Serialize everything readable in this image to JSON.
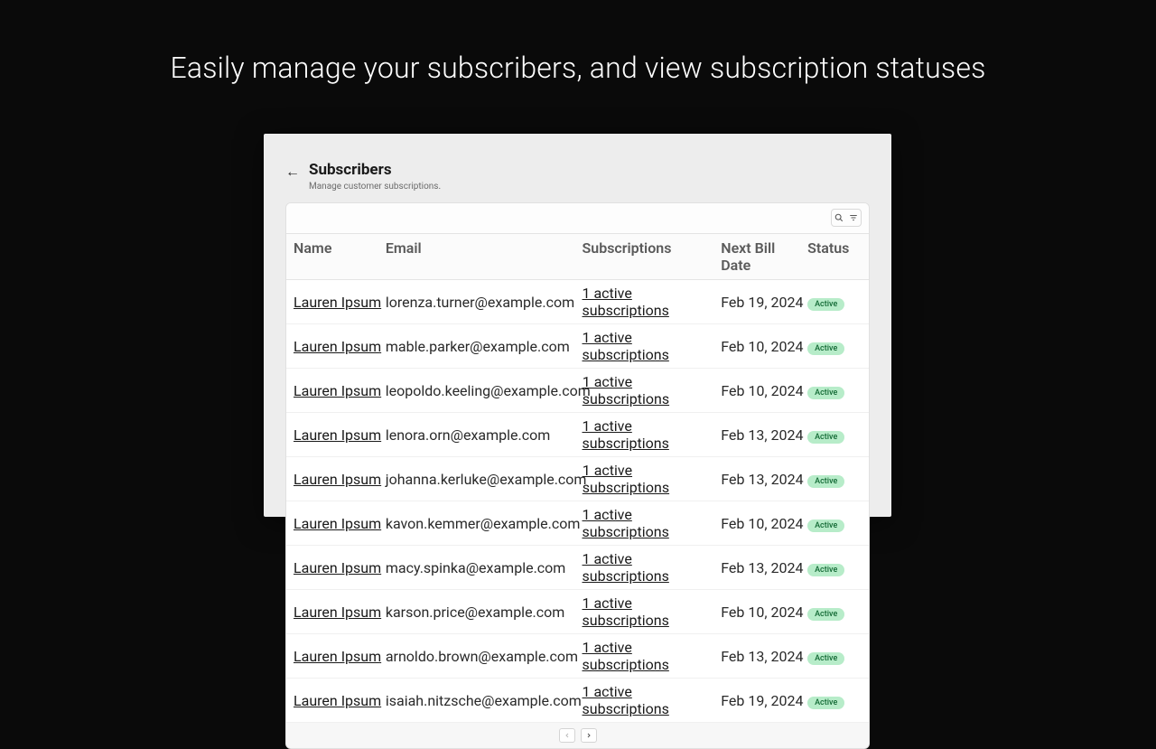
{
  "hero": "Easily manage your subscribers, and view subscription statuses",
  "header": {
    "title": "Subscribers",
    "subtitle": "Manage customer subscriptions."
  },
  "columns": {
    "name": "Name",
    "email": "Email",
    "subs": "Subscriptions",
    "date": "Next Bill Date",
    "status": "Status"
  },
  "status_label": "Active",
  "rows": [
    {
      "name": "Lauren Ipsum",
      "email": "lorenza.turner@example.com",
      "subs": "1 active subscriptions",
      "date": "Feb 19, 2024",
      "status": "Active"
    },
    {
      "name": "Lauren Ipsum",
      "email": "mable.parker@example.com",
      "subs": "1 active subscriptions",
      "date": "Feb 10, 2024",
      "status": "Active"
    },
    {
      "name": "Lauren Ipsum",
      "email": "leopoldo.keeling@example.com",
      "subs": "1 active subscriptions",
      "date": "Feb 10, 2024",
      "status": "Active"
    },
    {
      "name": "Lauren Ipsum",
      "email": "lenora.orn@example.com",
      "subs": "1 active subscriptions",
      "date": "Feb 13, 2024",
      "status": "Active"
    },
    {
      "name": "Lauren Ipsum",
      "email": "johanna.kerluke@example.com",
      "subs": "1 active subscriptions",
      "date": "Feb 13, 2024",
      "status": "Active"
    },
    {
      "name": "Lauren Ipsum",
      "email": "kavon.kemmer@example.com",
      "subs": "1 active subscriptions",
      "date": "Feb 10, 2024",
      "status": "Active"
    },
    {
      "name": "Lauren Ipsum",
      "email": "macy.spinka@example.com",
      "subs": "1 active subscriptions",
      "date": "Feb 13, 2024",
      "status": "Active"
    },
    {
      "name": "Lauren Ipsum",
      "email": "karson.price@example.com",
      "subs": "1 active subscriptions",
      "date": "Feb 10, 2024",
      "status": "Active"
    },
    {
      "name": "Lauren Ipsum",
      "email": "arnoldo.brown@example.com",
      "subs": "1 active subscriptions",
      "date": "Feb 13, 2024",
      "status": "Active"
    },
    {
      "name": "Lauren Ipsum",
      "email": "isaiah.nitzsche@example.com",
      "subs": "1 active subscriptions",
      "date": "Feb 19, 2024",
      "status": "Active"
    }
  ]
}
